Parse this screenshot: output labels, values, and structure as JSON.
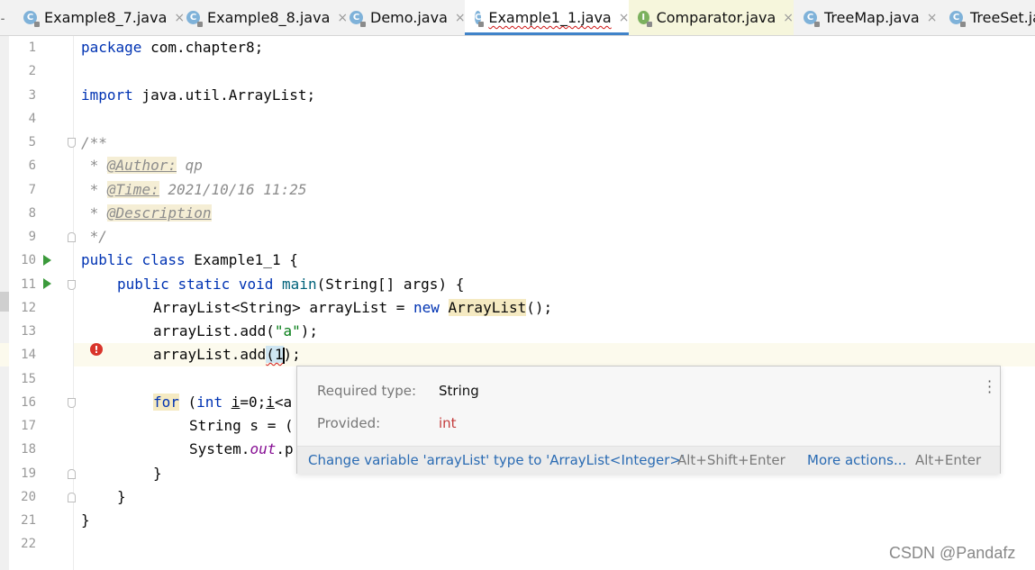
{
  "tabs": [
    {
      "label": "Example8_7.java",
      "icon": "class-icon",
      "close": "×"
    },
    {
      "label": "Example8_8.java",
      "icon": "class-icon",
      "close": "×"
    },
    {
      "label": "Demo.java",
      "icon": "class-icon",
      "close": "×"
    },
    {
      "label": "Example1_1.java",
      "icon": "class-icon",
      "close": "×"
    },
    {
      "label": "Comparator.java",
      "icon": "interface-icon",
      "close": "×"
    },
    {
      "label": "TreeMap.java",
      "icon": "class-icon",
      "close": "×"
    },
    {
      "label": "TreeSet.ja",
      "icon": "class-icon",
      "close": ""
    }
  ],
  "active_tab": "Example1_1.java",
  "line_numbers": [
    "1",
    "2",
    "3",
    "4",
    "5",
    "6",
    "7",
    "8",
    "9",
    "10",
    "11",
    "12",
    "13",
    "14",
    "15",
    "16",
    "17",
    "18",
    "19",
    "20",
    "21",
    "22"
  ],
  "code": {
    "l1": {
      "kw": "package",
      "rest": " com.chapter8;"
    },
    "l3": {
      "kw": "import",
      "rest": " java.util.ArrayList;"
    },
    "l5": "/**",
    "l6": {
      "pre": " * ",
      "tag": "@Author:",
      "rest": " qp"
    },
    "l7": {
      "pre": " * ",
      "tag": "@Time:",
      "rest": " 2021/10/16 11:25"
    },
    "l8": {
      "pre": " * ",
      "tag": "@Description"
    },
    "l9": " */",
    "l10": {
      "kw1": "public",
      "kw2": "class",
      "rest": " Example1_1 {"
    },
    "l11": {
      "kw1": "public",
      "kw2": "static",
      "kw3": "void",
      "fn": "main",
      "rest": "(String[] args) {"
    },
    "l12": {
      "a": "ArrayList<String> arrayList = ",
      "kw": "new",
      "hl": "ArrayList",
      "b": "();"
    },
    "l13": {
      "a": "arrayList.add(",
      "str": "\"a\"",
      "b": ");"
    },
    "l14": {
      "a": "arrayList.add",
      "err": "(1",
      "b": ");"
    },
    "l16": {
      "kw1": "for",
      "a": " (",
      "kw2": "int",
      "v1": "i",
      "b": "=0;",
      "v2": "i",
      "c": "<a"
    },
    "l17": "String s = (",
    "l18": {
      "a": "System.",
      "it": "out",
      "b": ".p"
    },
    "l19": "}",
    "l20": "}",
    "l21": "}"
  },
  "popup": {
    "required_label": "Required type:",
    "required_value": "String",
    "provided_label": "Provided:",
    "provided_value": "int",
    "more_icon": "more-vertical-icon",
    "fix_action": "Change variable 'arrayList' type to 'ArrayList<Integer>'",
    "fix_shortcut": "Alt+Shift+Enter",
    "more_actions": "More actions...",
    "more_shortcut": "Alt+Enter"
  },
  "watermark": "CSDN @Pandafz",
  "colors": {
    "keyword": "#0033b3",
    "string": "#067d17",
    "error": "#c43c3c",
    "link": "#2a6bb3",
    "tab_accent": "#4083c9"
  }
}
